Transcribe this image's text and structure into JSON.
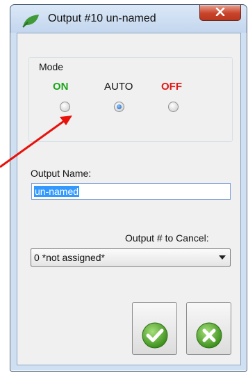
{
  "window": {
    "title": "Output #10 un-named",
    "app_icon": "leaf-icon",
    "close_icon": "close-icon"
  },
  "mode": {
    "title": "Mode",
    "options": [
      {
        "label": "ON",
        "color": "#1aa51a",
        "selected": false
      },
      {
        "label": "AUTO",
        "color": "#111111",
        "selected": true
      },
      {
        "label": "OFF",
        "color": "#e01818",
        "selected": false
      }
    ]
  },
  "output_name": {
    "label": "Output Name:",
    "value": "un-named"
  },
  "cancel": {
    "label": "Output  # to Cancel:",
    "selected": "0 *not assigned*"
  },
  "buttons": {
    "ok_icon": "checkmark-icon",
    "cancel_icon": "x-circle-icon"
  },
  "colors": {
    "accent_green": "#3aa31c",
    "annotation_red": "#e8120c"
  }
}
